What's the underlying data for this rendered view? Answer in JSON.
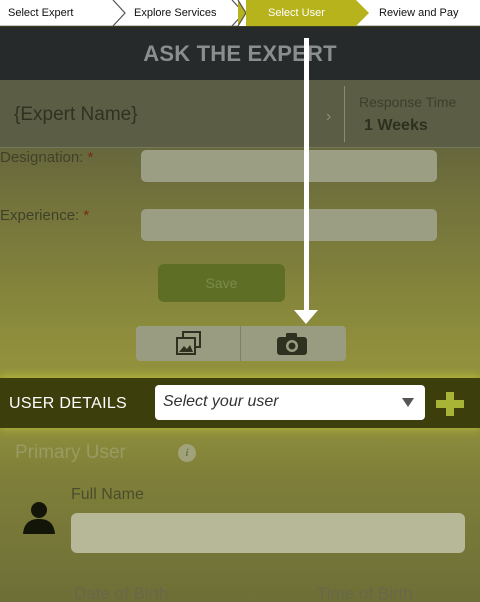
{
  "stepper": {
    "steps": [
      "Select Expert",
      "Explore Services",
      "Select User",
      "Review and Pay"
    ],
    "active_index": 2,
    "active_color": "#b6b31d"
  },
  "header": {
    "title": "ASK THE EXPERT"
  },
  "expert": {
    "name": "{Expert Name}",
    "response_time_label": "Response Time",
    "response_time_value": "1 Weeks"
  },
  "form": {
    "designation_label": "Designation:",
    "experience_label": "Experience:",
    "required_marker": "*",
    "save_label": "Save"
  },
  "media": {
    "gallery_icon": "gallery-icon",
    "camera_icon": "camera-icon"
  },
  "user_details": {
    "label": "USER DETAILS",
    "select_value": "Select your user",
    "add_icon": "plus-icon",
    "primary_user_label": "Primary User",
    "info_glyph": "i",
    "full_name_label": "Full Name",
    "dob_label": "Date of Birth",
    "tob_label": "Time of Birth"
  }
}
